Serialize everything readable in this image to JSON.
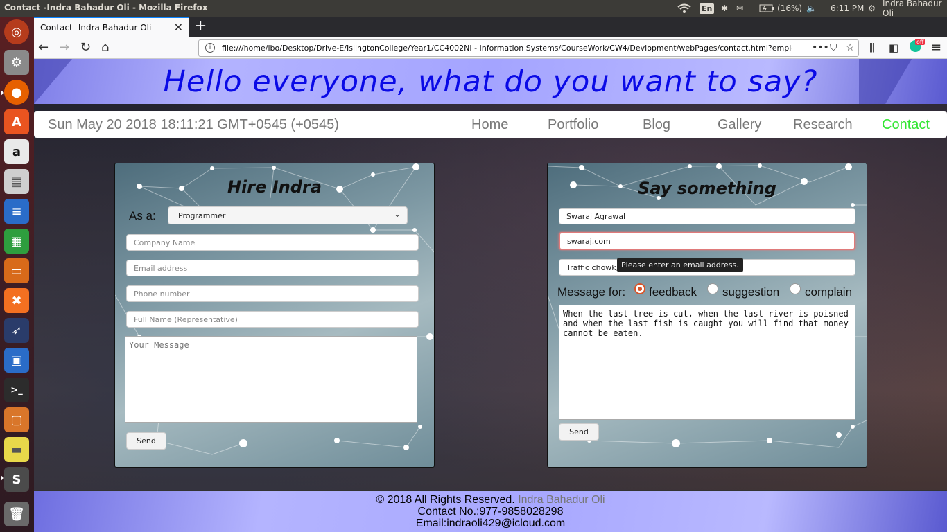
{
  "system": {
    "window_title": "Contact -Indra Bahadur Oli - Mozilla Firefox",
    "language": "En",
    "battery": "(16%)",
    "clock": "6:11 PM",
    "user": "Indra Bahadur Oli"
  },
  "launcher": {
    "apps": [
      "ubuntu-dash-icon",
      "system-settings-icon",
      "firefox-icon",
      "software-center-icon",
      "amazon-icon",
      "files-icon",
      "writer-icon",
      "calc-icon",
      "impress-icon",
      "xampp-icon",
      "bird-app-icon",
      "virtualbox-icon",
      "terminal-icon",
      "workspace-icon",
      "sticky-notes-icon",
      "sublime-text-icon",
      "trash-icon"
    ]
  },
  "browser": {
    "tab_title": "Contact -Indra Bahadur Oli",
    "url": "file:///home/ibo/Desktop/Drive-E/IslingtonCollege/Year1/CC4002NI - Information Systems/CourseWork/CW4/Devlopment/webPages/contact.html?employee=web&Com",
    "ext_badge": "off"
  },
  "page": {
    "banner_title": "Hello everyone, what do you want to say?",
    "date": "Sun May 20 2018 18:11:21 GMT+0545 (+0545)",
    "nav": [
      "Home",
      "Portfolio",
      "Blog",
      "Gallery",
      "Research",
      "Contact"
    ],
    "hire": {
      "title": "Hire Indra",
      "as_label": "As a:",
      "role_selected": "Programmer",
      "company_placeholder": "Company Name",
      "email_placeholder": "Email address",
      "phone_placeholder": "Phone number",
      "fullname_placeholder": "Full Name (Representative)",
      "message_placeholder": "Your Message",
      "send": "Send"
    },
    "say": {
      "title": "Say something",
      "name_value": "Swaraj Agrawal",
      "email_value": "swaraj.com",
      "address_value": "Traffic chowk,",
      "tooltip": "Please enter an email address.",
      "message_for_label": "Message for:",
      "options": [
        "feedback",
        "suggestion",
        "complain"
      ],
      "message_value": "When the last tree is cut, when the last river is poisned\nand when the last fish is caught you will find that money\ncannot be eaten.",
      "send": "Send"
    },
    "footer": {
      "rights": "© 2018 All Rights Reserved.",
      "author": "Indra Bahadur Oli",
      "contact": "Contact No.:977-9858028298",
      "email": "Email:indraoli429@icloud.com"
    }
  }
}
